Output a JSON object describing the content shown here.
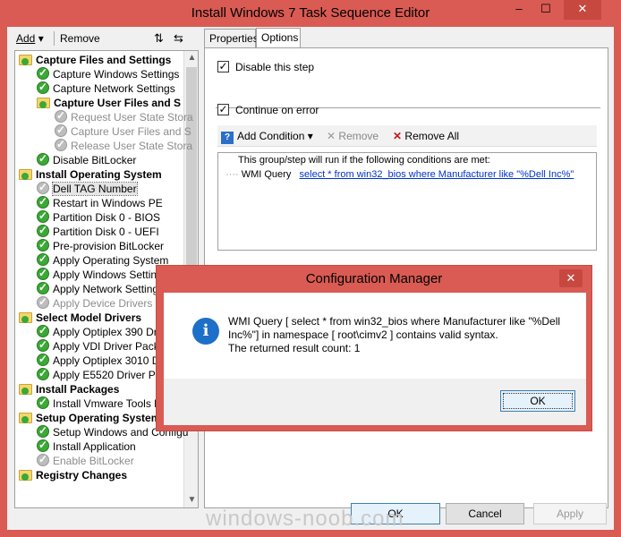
{
  "window": {
    "title": "Install Windows 7 Task Sequence Editor",
    "minimize": "–",
    "maximize": "☐",
    "close": "✕"
  },
  "toolbar": {
    "add_label": "Add",
    "remove_label": "Remove"
  },
  "tree": {
    "items": [
      {
        "label": "Capture Files and Settings",
        "type": "group",
        "indent": 0
      },
      {
        "label": "Capture Windows Settings",
        "type": "check",
        "indent": 1
      },
      {
        "label": "Capture Network Settings",
        "type": "check",
        "indent": 1
      },
      {
        "label": "Capture User Files and S",
        "type": "group",
        "indent": 1
      },
      {
        "label": "Request User State Stora",
        "type": "grey",
        "indent": 2,
        "disabled": true
      },
      {
        "label": "Capture User Files and S",
        "type": "grey",
        "indent": 2,
        "disabled": true
      },
      {
        "label": "Release User State Stora",
        "type": "grey",
        "indent": 2,
        "disabled": true
      },
      {
        "label": "Disable BitLocker",
        "type": "check",
        "indent": 1
      },
      {
        "label": "Install Operating System",
        "type": "group",
        "indent": 0
      },
      {
        "label": "Dell TAG Number",
        "type": "grey",
        "indent": 1,
        "selected": true
      },
      {
        "label": "Restart in Windows PE",
        "type": "check",
        "indent": 1
      },
      {
        "label": "Partition Disk 0 - BIOS",
        "type": "check",
        "indent": 1
      },
      {
        "label": "Partition Disk 0 - UEFI",
        "type": "check",
        "indent": 1
      },
      {
        "label": "Pre-provision BitLocker",
        "type": "check",
        "indent": 1
      },
      {
        "label": "Apply Operating System",
        "type": "check",
        "indent": 1
      },
      {
        "label": "Apply Windows Settings",
        "type": "check",
        "indent": 1
      },
      {
        "label": "Apply Network Settings",
        "type": "check",
        "indent": 1
      },
      {
        "label": "Apply Device Drivers",
        "type": "grey",
        "indent": 1,
        "disabled": true
      },
      {
        "label": "Select Model Drivers",
        "type": "group",
        "indent": 0
      },
      {
        "label": "Apply Optiplex 390 Driver",
        "type": "check",
        "indent": 1
      },
      {
        "label": "Apply VDI Driver Packag",
        "type": "check",
        "indent": 1
      },
      {
        "label": "Apply Optiplex 3010 Driv",
        "type": "check",
        "indent": 1
      },
      {
        "label": "Apply E5520 Driver Pack",
        "type": "check",
        "indent": 1
      },
      {
        "label": "Install Packages",
        "type": "group",
        "indent": 0
      },
      {
        "label": "Install Vmware Tools Pac",
        "type": "check",
        "indent": 1
      },
      {
        "label": "Setup Operating System",
        "type": "group",
        "indent": 0
      },
      {
        "label": "Setup Windows and Configu",
        "type": "check",
        "indent": 1
      },
      {
        "label": "Install Application",
        "type": "check",
        "indent": 1
      },
      {
        "label": "Enable BitLocker",
        "type": "grey",
        "indent": 1,
        "disabled": true
      },
      {
        "label": "Registry Changes",
        "type": "group",
        "indent": 0
      }
    ]
  },
  "tabs": [
    {
      "label": "Properties"
    },
    {
      "label": "Options"
    }
  ],
  "options": {
    "disable_step_label": "Disable this step",
    "continue_on_error_label": "Continue on error",
    "add_condition_label": "Add Condition",
    "remove_label": "Remove",
    "remove_all_label": "Remove All",
    "conditions_intro": "This group/step will run if the following conditions are met:",
    "condition_type": "WMI Query",
    "condition_value": "select * from win32_bios where Manufacturer like \"%Dell Inc%\""
  },
  "buttons": {
    "ok": "OK",
    "cancel": "Cancel",
    "apply": "Apply"
  },
  "watermark": "windows-noob.com",
  "dialog": {
    "title": "Configuration Manager",
    "close": "✕",
    "message_line1": "WMI Query [ select * from win32_bios where Manufacturer like \"%Dell",
    "message_line2": "Inc%\"]  in namespace [ root\\cimv2 ]  contains valid syntax.",
    "message_line3": "The returned result count: 1",
    "ok_label": "OK",
    "icon_glyph": "i"
  },
  "colors": {
    "frame": "#d95b53",
    "link": "#0033cc",
    "check": "#3aa935",
    "info": "#1e6fc7"
  }
}
